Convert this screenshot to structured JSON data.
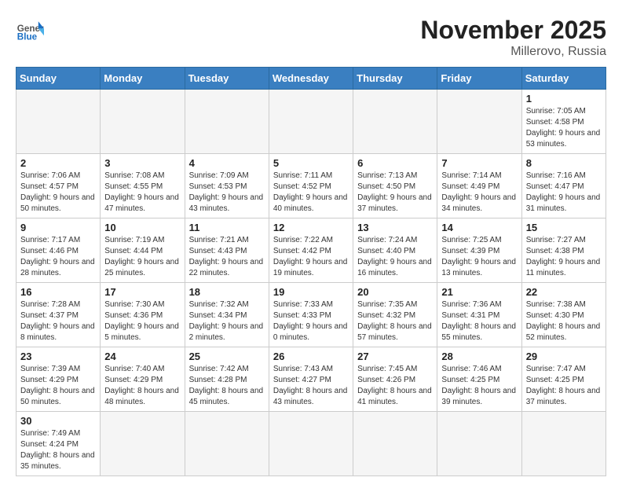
{
  "header": {
    "logo_general": "General",
    "logo_blue": "Blue",
    "month_year": "November 2025",
    "location": "Millerovo, Russia"
  },
  "weekdays": [
    "Sunday",
    "Monday",
    "Tuesday",
    "Wednesday",
    "Thursday",
    "Friday",
    "Saturday"
  ],
  "weeks": [
    [
      {
        "day": "",
        "info": ""
      },
      {
        "day": "",
        "info": ""
      },
      {
        "day": "",
        "info": ""
      },
      {
        "day": "",
        "info": ""
      },
      {
        "day": "",
        "info": ""
      },
      {
        "day": "",
        "info": ""
      },
      {
        "day": "1",
        "info": "Sunrise: 7:05 AM\nSunset: 4:58 PM\nDaylight: 9 hours and 53 minutes."
      }
    ],
    [
      {
        "day": "2",
        "info": "Sunrise: 7:06 AM\nSunset: 4:57 PM\nDaylight: 9 hours and 50 minutes."
      },
      {
        "day": "3",
        "info": "Sunrise: 7:08 AM\nSunset: 4:55 PM\nDaylight: 9 hours and 47 minutes."
      },
      {
        "day": "4",
        "info": "Sunrise: 7:09 AM\nSunset: 4:53 PM\nDaylight: 9 hours and 43 minutes."
      },
      {
        "day": "5",
        "info": "Sunrise: 7:11 AM\nSunset: 4:52 PM\nDaylight: 9 hours and 40 minutes."
      },
      {
        "day": "6",
        "info": "Sunrise: 7:13 AM\nSunset: 4:50 PM\nDaylight: 9 hours and 37 minutes."
      },
      {
        "day": "7",
        "info": "Sunrise: 7:14 AM\nSunset: 4:49 PM\nDaylight: 9 hours and 34 minutes."
      },
      {
        "day": "8",
        "info": "Sunrise: 7:16 AM\nSunset: 4:47 PM\nDaylight: 9 hours and 31 minutes."
      }
    ],
    [
      {
        "day": "9",
        "info": "Sunrise: 7:17 AM\nSunset: 4:46 PM\nDaylight: 9 hours and 28 minutes."
      },
      {
        "day": "10",
        "info": "Sunrise: 7:19 AM\nSunset: 4:44 PM\nDaylight: 9 hours and 25 minutes."
      },
      {
        "day": "11",
        "info": "Sunrise: 7:21 AM\nSunset: 4:43 PM\nDaylight: 9 hours and 22 minutes."
      },
      {
        "day": "12",
        "info": "Sunrise: 7:22 AM\nSunset: 4:42 PM\nDaylight: 9 hours and 19 minutes."
      },
      {
        "day": "13",
        "info": "Sunrise: 7:24 AM\nSunset: 4:40 PM\nDaylight: 9 hours and 16 minutes."
      },
      {
        "day": "14",
        "info": "Sunrise: 7:25 AM\nSunset: 4:39 PM\nDaylight: 9 hours and 13 minutes."
      },
      {
        "day": "15",
        "info": "Sunrise: 7:27 AM\nSunset: 4:38 PM\nDaylight: 9 hours and 11 minutes."
      }
    ],
    [
      {
        "day": "16",
        "info": "Sunrise: 7:28 AM\nSunset: 4:37 PM\nDaylight: 9 hours and 8 minutes."
      },
      {
        "day": "17",
        "info": "Sunrise: 7:30 AM\nSunset: 4:36 PM\nDaylight: 9 hours and 5 minutes."
      },
      {
        "day": "18",
        "info": "Sunrise: 7:32 AM\nSunset: 4:34 PM\nDaylight: 9 hours and 2 minutes."
      },
      {
        "day": "19",
        "info": "Sunrise: 7:33 AM\nSunset: 4:33 PM\nDaylight: 9 hours and 0 minutes."
      },
      {
        "day": "20",
        "info": "Sunrise: 7:35 AM\nSunset: 4:32 PM\nDaylight: 8 hours and 57 minutes."
      },
      {
        "day": "21",
        "info": "Sunrise: 7:36 AM\nSunset: 4:31 PM\nDaylight: 8 hours and 55 minutes."
      },
      {
        "day": "22",
        "info": "Sunrise: 7:38 AM\nSunset: 4:30 PM\nDaylight: 8 hours and 52 minutes."
      }
    ],
    [
      {
        "day": "23",
        "info": "Sunrise: 7:39 AM\nSunset: 4:29 PM\nDaylight: 8 hours and 50 minutes."
      },
      {
        "day": "24",
        "info": "Sunrise: 7:40 AM\nSunset: 4:29 PM\nDaylight: 8 hours and 48 minutes."
      },
      {
        "day": "25",
        "info": "Sunrise: 7:42 AM\nSunset: 4:28 PM\nDaylight: 8 hours and 45 minutes."
      },
      {
        "day": "26",
        "info": "Sunrise: 7:43 AM\nSunset: 4:27 PM\nDaylight: 8 hours and 43 minutes."
      },
      {
        "day": "27",
        "info": "Sunrise: 7:45 AM\nSunset: 4:26 PM\nDaylight: 8 hours and 41 minutes."
      },
      {
        "day": "28",
        "info": "Sunrise: 7:46 AM\nSunset: 4:25 PM\nDaylight: 8 hours and 39 minutes."
      },
      {
        "day": "29",
        "info": "Sunrise: 7:47 AM\nSunset: 4:25 PM\nDaylight: 8 hours and 37 minutes."
      }
    ],
    [
      {
        "day": "30",
        "info": "Sunrise: 7:49 AM\nSunset: 4:24 PM\nDaylight: 8 hours and 35 minutes."
      },
      {
        "day": "",
        "info": ""
      },
      {
        "day": "",
        "info": ""
      },
      {
        "day": "",
        "info": ""
      },
      {
        "day": "",
        "info": ""
      },
      {
        "day": "",
        "info": ""
      },
      {
        "day": "",
        "info": ""
      }
    ]
  ]
}
